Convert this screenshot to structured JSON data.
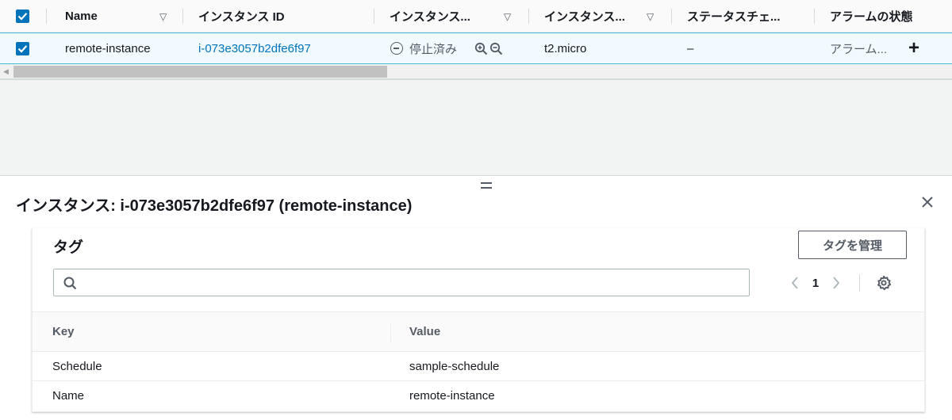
{
  "instances_table": {
    "columns": [
      {
        "label": "Name",
        "sortable": true
      },
      {
        "label": "インスタンス ID",
        "sortable": false
      },
      {
        "label": "インスタンス...",
        "sortable": true
      },
      {
        "label": "インスタンス...",
        "sortable": true
      },
      {
        "label": "ステータスチェ...",
        "sortable": false
      },
      {
        "label": "アラームの状態",
        "sortable": false
      }
    ],
    "row": {
      "selected": true,
      "name": "remote-instance",
      "instance_id": "i-073e3057b2dfe6f97",
      "state": "停止済み",
      "instance_type": "t2.micro",
      "status_check": "–",
      "alarm_status": "アラーム...",
      "alarm_add_symbol": "+"
    }
  },
  "details_pane": {
    "title": "インスタンス: i-073e3057b2dfe6f97 (remote-instance)",
    "close_icon": "close-icon",
    "tags_card": {
      "title": "タグ",
      "manage_button": "タグを管理",
      "search_value": "",
      "search_placeholder": "",
      "current_page": "1",
      "columns": [
        "Key",
        "Value"
      ],
      "rows": [
        {
          "key": "Schedule",
          "value": "sample-schedule"
        },
        {
          "key": "Name",
          "value": "remote-instance"
        }
      ]
    }
  },
  "colors": {
    "link": "#0073bb",
    "selected_row_bg": "#f1faff",
    "selected_row_border": "#44b9d6",
    "checkbox": "#0073bb"
  }
}
